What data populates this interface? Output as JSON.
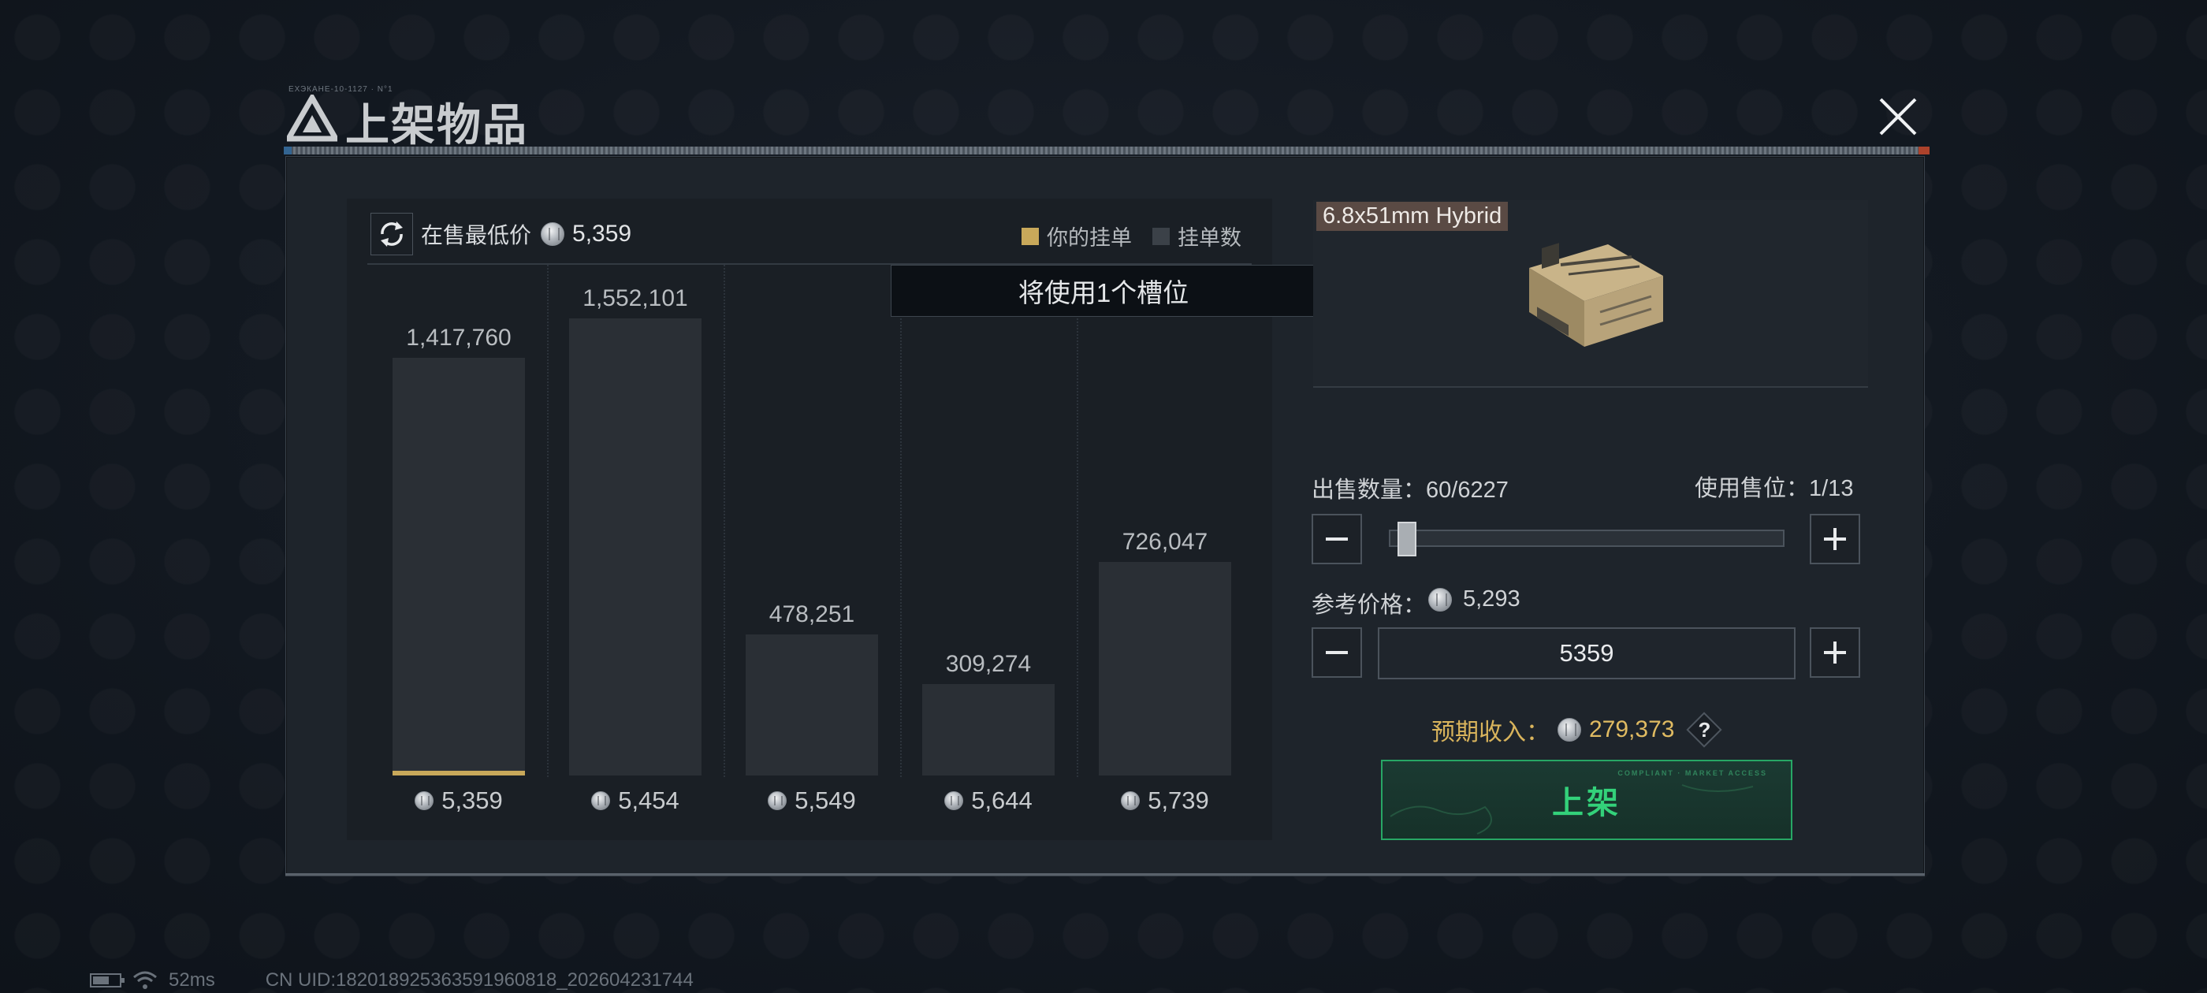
{
  "dialog": {
    "title": "上架物品",
    "title_tag": "ЕХЭКАНЕ-10-1127 · N°1"
  },
  "chart_panel": {
    "lowest_price_label": "在售最低价",
    "lowest_price_value": "5,359",
    "legend": {
      "your_order": "你的挂单",
      "order_count": "挂单数",
      "your_order_color": "#c8a85a",
      "order_count_color": "#3b4148"
    },
    "tooltip": "将使用1个槽位"
  },
  "chart_data": {
    "type": "bar",
    "categories": [
      "5,359",
      "5,454",
      "5,549",
      "5,644",
      "5,739"
    ],
    "values": [
      1417760,
      1552101,
      478251,
      309274,
      726047
    ],
    "value_labels": [
      "1,417,760",
      "1,552,101",
      "478,251",
      "309,274",
      "726,047"
    ],
    "ylim": [
      0,
      1552101
    ],
    "highlighted_category": "5,359",
    "highlight_color": "#c8a85a",
    "bar_color": "#2a2f35"
  },
  "item": {
    "name": "6.8x51mm Hybrid",
    "icon": "ammo-box-icon"
  },
  "sell": {
    "quantity_label": "出售数量：60/6227",
    "slots_label": "使用售位：1/13",
    "slider_fraction": 0.0096,
    "ref_price_label": "参考价格：",
    "ref_price_value": "5,293",
    "price_input_value": "5359",
    "income_label": "预期收入：",
    "income_value": "279,373",
    "help_label": "?",
    "list_button_label": "上架",
    "list_button_tech_text": "COMPLIANT · MARKET ACCESS"
  },
  "footer": {
    "ping": "52ms",
    "uid": "CN UID:182018925363591960818_202604231744"
  }
}
